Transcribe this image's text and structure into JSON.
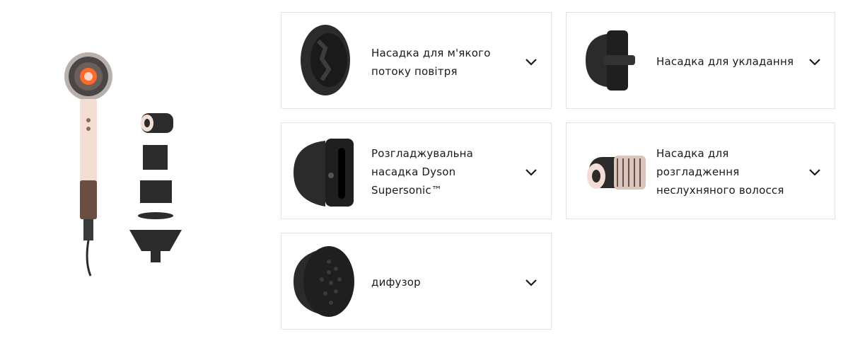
{
  "accessories": [
    {
      "label": "Насадка для м'якого\nпотоку повітря",
      "icon": "gentle-air-attachment-icon",
      "expand_icon": "chevron-down-icon"
    },
    {
      "label": "Насадка для укладання",
      "icon": "styling-concentrator-icon",
      "expand_icon": "chevron-down-icon"
    },
    {
      "label": "Розгладжувальна\nнасадка Dyson\nSupersonic™",
      "icon": "smoothing-nozzle-icon",
      "expand_icon": "chevron-down-icon"
    },
    {
      "label": "Насадка для\nрозгладження\nнеслухняного волосся",
      "icon": "flyaway-attachment-icon",
      "expand_icon": "chevron-down-icon"
    },
    {
      "label": "дифузор",
      "icon": "diffuser-icon",
      "expand_icon": "chevron-down-icon"
    }
  ],
  "colors": {
    "border": "#e3e3e3",
    "text": "#1a1a1a",
    "attachment": "#2b2b2b",
    "dryer_body": "#f3ddd4",
    "accent": "#ff6a2b"
  }
}
